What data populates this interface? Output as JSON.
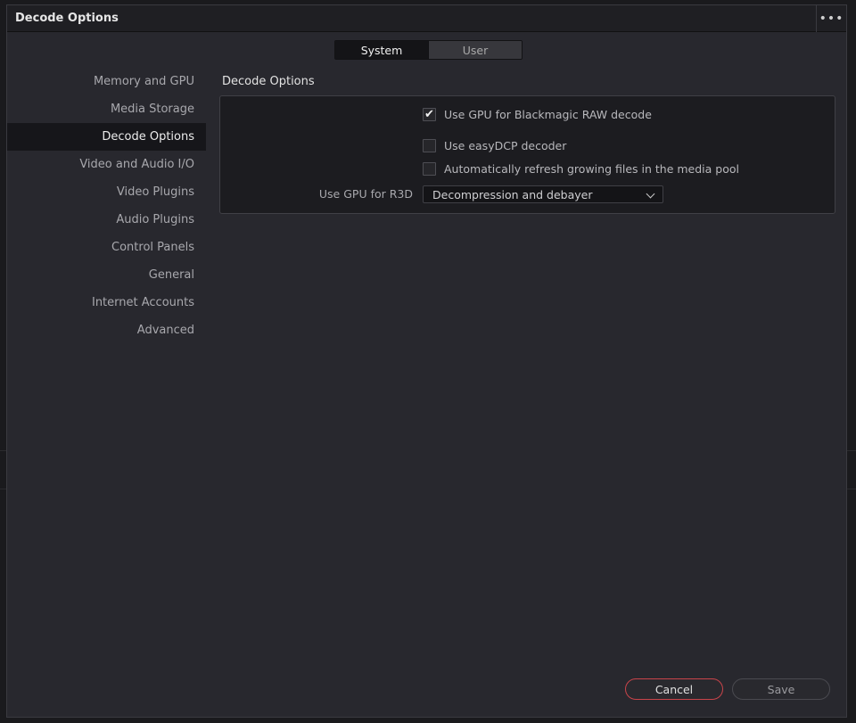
{
  "window": {
    "title": "Decode Options",
    "more_icon": "more-horizontal-icon"
  },
  "tabs": [
    {
      "label": "System",
      "active": true
    },
    {
      "label": "User",
      "active": false
    }
  ],
  "sidebar": {
    "items": [
      {
        "label": "Memory and GPU"
      },
      {
        "label": "Media Storage"
      },
      {
        "label": "Decode Options",
        "active": true
      },
      {
        "label": "Video and Audio I/O"
      },
      {
        "label": "Video Plugins"
      },
      {
        "label": "Audio Plugins"
      },
      {
        "label": "Control Panels"
      },
      {
        "label": "General"
      },
      {
        "label": "Internet Accounts"
      },
      {
        "label": "Advanced"
      }
    ]
  },
  "section": {
    "title": "Decode Options",
    "options": {
      "gpu_braw": {
        "label": "Use GPU for Blackmagic RAW decode",
        "checked": true
      },
      "easydcp": {
        "label": "Use easyDCP decoder",
        "checked": false
      },
      "auto_refresh": {
        "label": "Automatically refresh growing files in the media pool",
        "checked": false
      }
    },
    "r3d": {
      "label": "Use GPU for R3D",
      "value": "Decompression and debayer"
    }
  },
  "footer": {
    "cancel_label": "Cancel",
    "save_label": "Save"
  },
  "colors": {
    "accent_cancel_border": "#c9444a",
    "dialog_bg": "#28282e",
    "panel_bg": "#1c1c20"
  }
}
